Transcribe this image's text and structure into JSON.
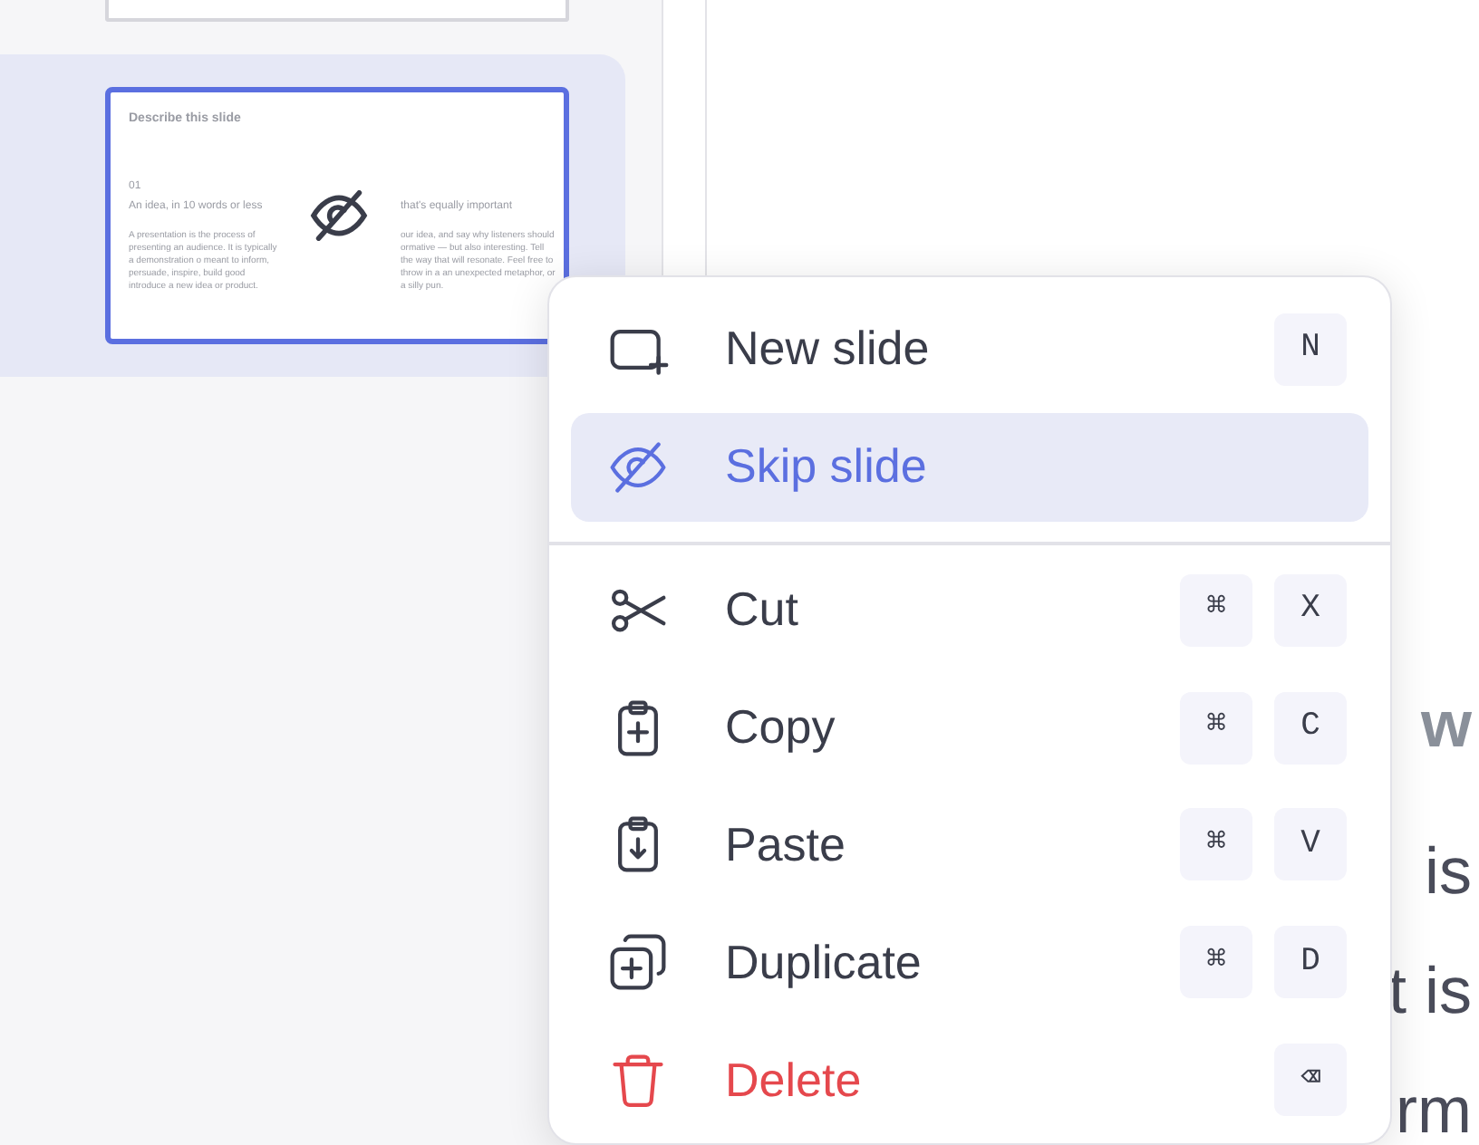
{
  "slides_panel": {
    "thumbnails": [
      {
        "selected": false
      },
      {
        "selected": true,
        "skipped": true,
        "heading": "Describe this slide",
        "number": "01",
        "left_title": "An idea, in 10 words or less",
        "left_body": "A presentation is the process of presenting an audience. It is typically a demonstration o meant to inform, persuade, inspire, build good introduce a new idea or product.",
        "right_title": "that's equally important",
        "right_body": "our idea, and say why listeners should ormative — but also interesting. Tell the way that will resonate. Feel free to throw in a an unexpected metaphor, or a silly pun."
      }
    ]
  },
  "editor_fragments": [
    {
      "kind": "heading",
      "text": "w"
    },
    {
      "kind": "body",
      "text": "is"
    },
    {
      "kind": "body",
      "text": "t is"
    },
    {
      "kind": "body",
      "text": "rm"
    }
  ],
  "context_menu": {
    "items": [
      {
        "kind": "normal",
        "label": "New slide",
        "selected": false,
        "keys": [
          "N"
        ]
      },
      {
        "kind": "normal",
        "label": "Skip slide",
        "selected": true
      },
      {
        "kind": "divider"
      },
      {
        "kind": "normal",
        "label": "Cut",
        "selected": false,
        "keys": [
          "⌘",
          "X"
        ]
      },
      {
        "kind": "normal",
        "label": "Copy",
        "selected": false,
        "keys": [
          "⌘",
          "C"
        ]
      },
      {
        "kind": "normal",
        "label": "Paste",
        "selected": false,
        "keys": [
          "⌘",
          "V"
        ]
      },
      {
        "kind": "normal",
        "label": "Duplicate",
        "selected": false,
        "keys": [
          "⌘",
          "D"
        ]
      },
      {
        "kind": "danger",
        "label": "Delete",
        "selected": false,
        "keys": [
          "⌫"
        ]
      }
    ]
  }
}
